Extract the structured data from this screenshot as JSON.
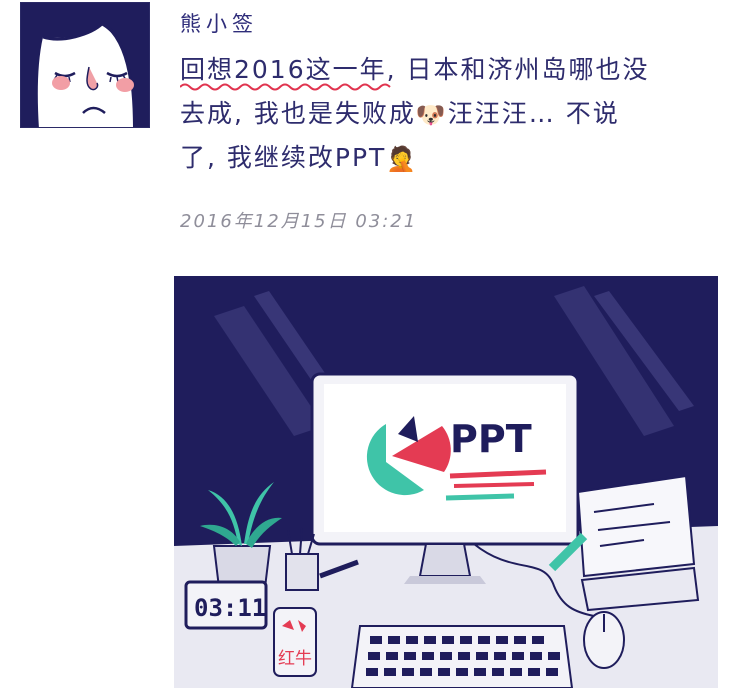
{
  "post": {
    "username": "熊小签",
    "text_line1_highlight": "回想2016这一年,",
    "text_line1_rest": " 日本和济州岛哪也没",
    "text_line2_a": "去成, 我也是失败成",
    "text_line2_b": "汪汪汪… 不说",
    "text_line3": "了, 我继续改PPT",
    "emoji_dog": "🐶",
    "emoji_face": "🤦",
    "timestamp": "2016年12月15日   03:21"
  },
  "illustration": {
    "monitor_title": "PPT",
    "clock_time": "03:11",
    "can_label": "红牛"
  },
  "colors": {
    "navy": "#1f1d5c",
    "teal": "#3fc4a8",
    "red": "#e43b53",
    "wavy": "#e0334e"
  }
}
